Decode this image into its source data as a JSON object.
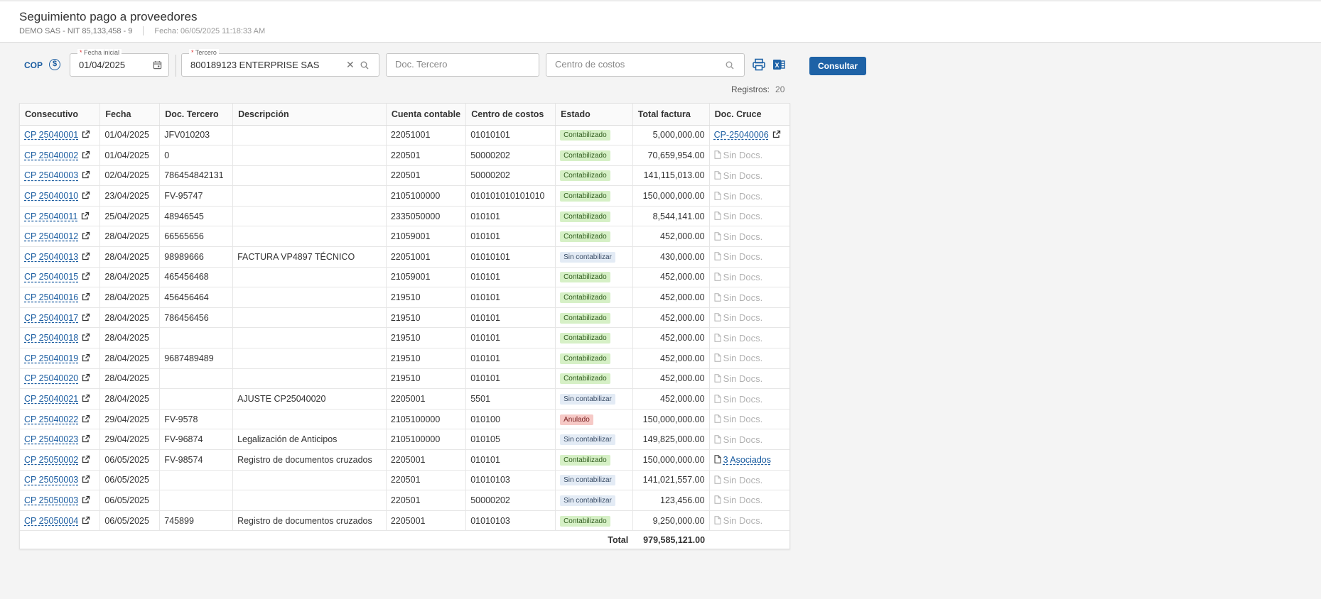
{
  "header": {
    "title": "Seguimiento pago a proveedores",
    "company": "DEMO SAS - NIT 85,133,458 - 9",
    "date": "Fecha: 06/05/2025 11:18:33 AM"
  },
  "filters": {
    "currency": "COP",
    "currency_icon": "dollar-circle-icon",
    "fecha_label": "Fecha inicial",
    "fecha_value": "01/04/2025",
    "tercero_label": "Tercero",
    "tercero_value": "800189123 ENTERPRISE SAS",
    "doc_tercero_placeholder": "Doc. Tercero",
    "centro_placeholder": "Centro de costos",
    "consultar_label": "Consultar",
    "required_mark": "*"
  },
  "registros": {
    "label": "Registros:",
    "count": "20"
  },
  "colors": {
    "accent": "#1e62a6",
    "link": "#1a5ca0",
    "contabilizado": "#d6f0c6",
    "sin_contabilizar": "#e3ebf5",
    "anulado": "#f6c9c6"
  },
  "table": {
    "headers": [
      "Consecutivo",
      "Fecha",
      "Doc. Tercero",
      "Descripción",
      "Cuenta contable",
      "Centro de costos",
      "Estado",
      "Total factura",
      "Doc. Cruce"
    ],
    "rows": [
      {
        "consecutivo": "CP 25040001",
        "fecha": "01/04/2025",
        "doc": "JFV010203",
        "desc": "",
        "cuenta": "22051001",
        "centro": "01010101",
        "estado": "Contabilizado",
        "estado_kind": "cont",
        "total": "5,000,000.00",
        "cruce": "CP-25040006",
        "cruce_kind": "link"
      },
      {
        "consecutivo": "CP 25040002",
        "fecha": "01/04/2025",
        "doc": "0",
        "desc": "",
        "cuenta": "220501",
        "centro": "50000202",
        "estado": "Contabilizado",
        "estado_kind": "cont",
        "total": "70,659,954.00",
        "cruce": "Sin Docs.",
        "cruce_kind": "none"
      },
      {
        "consecutivo": "CP 25040003",
        "fecha": "02/04/2025",
        "doc": "786454842131",
        "desc": "",
        "cuenta": "220501",
        "centro": "50000202",
        "estado": "Contabilizado",
        "estado_kind": "cont",
        "total": "141,115,013.00",
        "cruce": "Sin Docs.",
        "cruce_kind": "none"
      },
      {
        "consecutivo": "CP 25040010",
        "fecha": "23/04/2025",
        "doc": "FV-95747",
        "desc": "",
        "cuenta": "2105100000",
        "centro": "010101010101010",
        "estado": "Contabilizado",
        "estado_kind": "cont",
        "total": "150,000,000.00",
        "cruce": "Sin Docs.",
        "cruce_kind": "none"
      },
      {
        "consecutivo": "CP 25040011",
        "fecha": "25/04/2025",
        "doc": "48946545",
        "desc": "",
        "cuenta": "2335050000",
        "centro": "010101",
        "estado": "Contabilizado",
        "estado_kind": "cont",
        "total": "8,544,141.00",
        "cruce": "Sin Docs.",
        "cruce_kind": "none"
      },
      {
        "consecutivo": "CP 25040012",
        "fecha": "28/04/2025",
        "doc": "66565656",
        "desc": "",
        "cuenta": "21059001",
        "centro": "010101",
        "estado": "Contabilizado",
        "estado_kind": "cont",
        "total": "452,000.00",
        "cruce": "Sin Docs.",
        "cruce_kind": "none"
      },
      {
        "consecutivo": "CP 25040013",
        "fecha": "28/04/2025",
        "doc": "98989666",
        "desc": "FACTURA VP4897 TÉCNICO",
        "cuenta": "22051001",
        "centro": "01010101",
        "estado": "Sin contabilizar",
        "estado_kind": "sin",
        "total": "430,000.00",
        "cruce": "Sin Docs.",
        "cruce_kind": "none"
      },
      {
        "consecutivo": "CP 25040015",
        "fecha": "28/04/2025",
        "doc": "465456468",
        "desc": "",
        "cuenta": "21059001",
        "centro": "010101",
        "estado": "Contabilizado",
        "estado_kind": "cont",
        "total": "452,000.00",
        "cruce": "Sin Docs.",
        "cruce_kind": "none"
      },
      {
        "consecutivo": "CP 25040016",
        "fecha": "28/04/2025",
        "doc": "456456464",
        "desc": "",
        "cuenta": "219510",
        "centro": "010101",
        "estado": "Contabilizado",
        "estado_kind": "cont",
        "total": "452,000.00",
        "cruce": "Sin Docs.",
        "cruce_kind": "none"
      },
      {
        "consecutivo": "CP 25040017",
        "fecha": "28/04/2025",
        "doc": "786456456",
        "desc": "",
        "cuenta": "219510",
        "centro": "010101",
        "estado": "Contabilizado",
        "estado_kind": "cont",
        "total": "452,000.00",
        "cruce": "Sin Docs.",
        "cruce_kind": "none"
      },
      {
        "consecutivo": "CP 25040018",
        "fecha": "28/04/2025",
        "doc": "",
        "desc": "",
        "cuenta": "219510",
        "centro": "010101",
        "estado": "Contabilizado",
        "estado_kind": "cont",
        "total": "452,000.00",
        "cruce": "Sin Docs.",
        "cruce_kind": "none"
      },
      {
        "consecutivo": "CP 25040019",
        "fecha": "28/04/2025",
        "doc": "9687489489",
        "desc": "",
        "cuenta": "219510",
        "centro": "010101",
        "estado": "Contabilizado",
        "estado_kind": "cont",
        "total": "452,000.00",
        "cruce": "Sin Docs.",
        "cruce_kind": "none"
      },
      {
        "consecutivo": "CP 25040020",
        "fecha": "28/04/2025",
        "doc": "",
        "desc": "",
        "cuenta": "219510",
        "centro": "010101",
        "estado": "Contabilizado",
        "estado_kind": "cont",
        "total": "452,000.00",
        "cruce": "Sin Docs.",
        "cruce_kind": "none"
      },
      {
        "consecutivo": "CP 25040021",
        "fecha": "28/04/2025",
        "doc": "",
        "desc": "AJUSTE CP25040020",
        "cuenta": "2205001",
        "centro": "5501",
        "estado": "Sin contabilizar",
        "estado_kind": "sin",
        "total": "452,000.00",
        "cruce": "Sin Docs.",
        "cruce_kind": "none"
      },
      {
        "consecutivo": "CP 25040022",
        "fecha": "29/04/2025",
        "doc": "FV-9578",
        "desc": "",
        "cuenta": "2105100000",
        "centro": "010100",
        "estado": "Anulado",
        "estado_kind": "anu",
        "total": "150,000,000.00",
        "cruce": "Sin Docs.",
        "cruce_kind": "none"
      },
      {
        "consecutivo": "CP 25040023",
        "fecha": "29/04/2025",
        "doc": "FV-96874",
        "desc": "Legalización de Anticipos",
        "cuenta": "2105100000",
        "centro": "010105",
        "estado": "Sin contabilizar",
        "estado_kind": "sin",
        "total": "149,825,000.00",
        "cruce": "Sin Docs.",
        "cruce_kind": "none"
      },
      {
        "consecutivo": "CP 25050002",
        "fecha": "06/05/2025",
        "doc": "FV-98574",
        "desc": "Registro de documentos cruzados",
        "cuenta": "2205001",
        "centro": "010101",
        "estado": "Contabilizado",
        "estado_kind": "cont",
        "total": "150,000,000.00",
        "cruce": "3 Asociados",
        "cruce_kind": "assoc"
      },
      {
        "consecutivo": "CP 25050003",
        "fecha": "06/05/2025",
        "doc": "",
        "desc": "",
        "cuenta": "220501",
        "centro": "01010103",
        "estado": "Sin contabilizar",
        "estado_kind": "sin",
        "total": "141,021,557.00",
        "cruce": "Sin Docs.",
        "cruce_kind": "none"
      },
      {
        "consecutivo": "CP 25050003",
        "fecha": "06/05/2025",
        "doc": "",
        "desc": "",
        "cuenta": "220501",
        "centro": "50000202",
        "estado": "Sin contabilizar",
        "estado_kind": "sin",
        "total": "123,456.00",
        "cruce": "Sin Docs.",
        "cruce_kind": "none"
      },
      {
        "consecutivo": "CP 25050004",
        "fecha": "06/05/2025",
        "doc": "745899",
        "desc": "Registro de documentos cruzados",
        "cuenta": "2205001",
        "centro": "01010103",
        "estado": "Contabilizado",
        "estado_kind": "cont",
        "total": "9,250,000.00",
        "cruce": "Sin Docs.",
        "cruce_kind": "none"
      }
    ],
    "total_label": "Total",
    "total_value": "979,585,121.00"
  }
}
